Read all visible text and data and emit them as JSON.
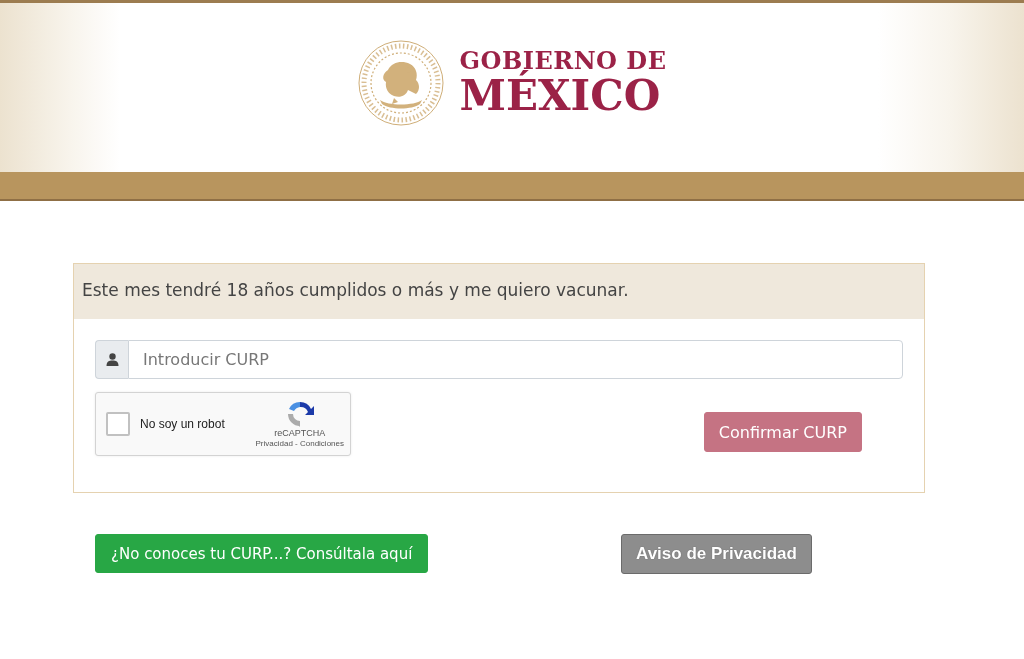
{
  "header": {
    "logo": {
      "line_1": "GOBIERNO DE",
      "line_2": "MÉXICO"
    }
  },
  "form": {
    "heading": "Este mes tendré 18 años cumplidos o más y me quiero vacunar.",
    "curp_field": {
      "placeholder": "Introducir CURP"
    },
    "captcha": {
      "checked": false,
      "label": "No soy un robot",
      "brand": "reCAPTCHA",
      "terms": "Privacidad - Condiciones"
    },
    "confirm_button": {
      "label": "Confirmar CURP",
      "disabled": true
    }
  },
  "links": [
    {
      "kind": "success",
      "label": "¿No conoces tu CURP...? Consúltala aquí"
    },
    {
      "kind": "secondary",
      "label": "Aviso de Privacidad"
    }
  ]
}
